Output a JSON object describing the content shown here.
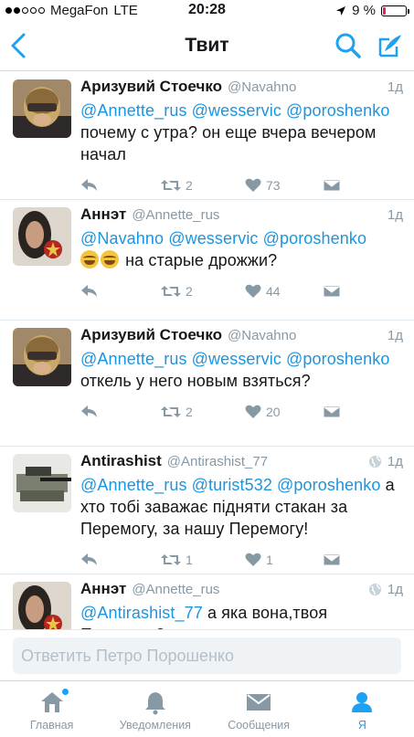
{
  "status_bar": {
    "carrier": "MegaFon",
    "network": "LTE",
    "time": "20:28",
    "battery": "9 %",
    "signal_bars": 2,
    "battery_level": 0.09,
    "battery_color": "#e0245e"
  },
  "nav": {
    "title": "Твит",
    "back_icon": "chevron-left-icon",
    "search_icon": "search-icon",
    "compose_icon": "compose-icon"
  },
  "tweets": [
    {
      "name": "Аризувий Стоечко",
      "handle": "@Navahno",
      "time": "1д",
      "mentions": "@Annette_rus @wesservic @poroshenko",
      "text": "почему с утра? он еще вчера вечером начал",
      "retweets": "2",
      "likes": "73"
    },
    {
      "name": "Аннэт",
      "handle": "@Annette_rus",
      "time": "1д",
      "mentions": "@Navahno @wesservic @poroshenko",
      "text": "на старые дрожжи?",
      "retweets": "2",
      "likes": "44"
    },
    {
      "name": "Аризувий Стоечко",
      "handle": "@Navahno",
      "time": "1д",
      "mentions": "@Annette_rus @wesservic @poroshenko",
      "text": "откель у него новым взяться?",
      "retweets": "2",
      "likes": "20"
    },
    {
      "name": "Antirashist",
      "handle": "@Antirashist_77",
      "time": "1д",
      "mentions": "@Annette_rus @turist532 @poroshenko",
      "text": "а хто тобі заважає підняти стакан за Перемогу,  за нашу Перемогу!",
      "retweets": "1",
      "likes": "1"
    },
    {
      "name": "Аннэт",
      "handle": "@Annette_rus",
      "time": "1д",
      "mentions": "@Antirashist_77",
      "text": "а яка вона,твоя Перемога?",
      "retweets": "",
      "likes": ""
    }
  ],
  "reply": {
    "placeholder": "Ответить Петро Порошенко"
  },
  "tabs": [
    {
      "label": "Главная",
      "icon": "home-icon"
    },
    {
      "label": "Уведомления",
      "icon": "bell-icon"
    },
    {
      "label": "Сообщения",
      "icon": "envelope-icon"
    },
    {
      "label": "Я",
      "icon": "person-icon"
    }
  ],
  "colors": {
    "accent": "#1da1f2",
    "mention": "#1b95e0",
    "muted": "#8899a6"
  }
}
